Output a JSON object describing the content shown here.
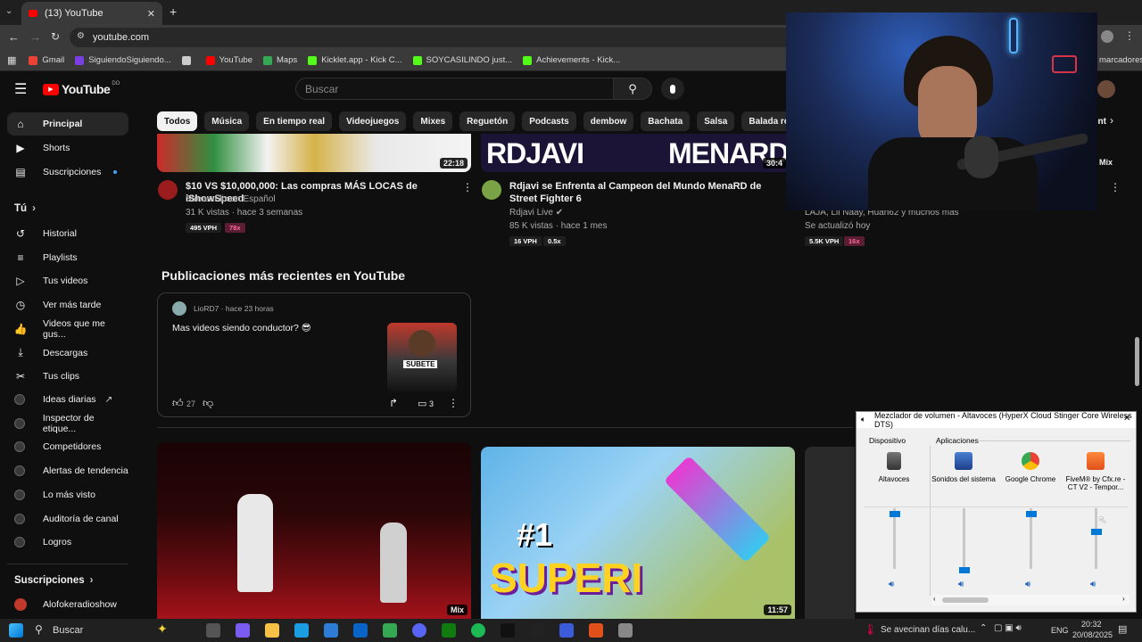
{
  "browser": {
    "tab_title": "(13) YouTube",
    "url": "youtube.com",
    "bookmarks": [
      {
        "label": "Gmail",
        "color": "#ea4335"
      },
      {
        "label": "SiguiendoSiguiendo...",
        "color": "#7b3fe4"
      },
      {
        "label": "",
        "color": "#cccccc"
      },
      {
        "label": "YouTube",
        "color": "#ff0000"
      },
      {
        "label": "Maps",
        "color": "#34a853"
      },
      {
        "label": "Kicklet.app - Kick C...",
        "color": "#53fc18"
      },
      {
        "label": "SOYCASILINDO just...",
        "color": "#53fc18"
      },
      {
        "label": "Achievements - Kick...",
        "color": "#53fc18"
      }
    ],
    "bookmarks_right": "marcadores"
  },
  "youtube": {
    "logo": "YouTube",
    "logo_sup": "DO",
    "search_placeholder": "Buscar",
    "chips": [
      "Todos",
      "Música",
      "En tiempo real",
      "Videojuegos",
      "Mixes",
      "Reguetón",
      "Podcasts",
      "dembow",
      "Bachata",
      "Salsa",
      "Balada románticas"
    ],
    "chip_partial": "ent"
  },
  "sidebar": {
    "top": [
      {
        "label": "Principal",
        "icon": "home-icon",
        "glyph": "⌂"
      },
      {
        "label": "Shorts",
        "icon": "shorts-icon",
        "glyph": "▶"
      },
      {
        "label": "Suscripciones",
        "icon": "subscriptions-icon",
        "glyph": "▤"
      }
    ],
    "you_heading": "Tú",
    "you": [
      {
        "label": "Historial",
        "icon": "history-icon",
        "glyph": "↺"
      },
      {
        "label": "Playlists",
        "icon": "playlists-icon",
        "glyph": "≡"
      },
      {
        "label": "Tus videos",
        "icon": "your-videos-icon",
        "glyph": "▷"
      },
      {
        "label": "Ver más tarde",
        "icon": "watch-later-icon",
        "glyph": "◷"
      },
      {
        "label": "Videos que me gus...",
        "icon": "liked-icon",
        "glyph": "👍"
      },
      {
        "label": "Descargas",
        "icon": "downloads-icon",
        "glyph": "⤓"
      },
      {
        "label": "Tus clips",
        "icon": "clips-icon",
        "glyph": "✂"
      }
    ],
    "tools": [
      {
        "label": "Ideas diarias"
      },
      {
        "label": "Inspector de etique..."
      },
      {
        "label": "Competidores"
      },
      {
        "label": "Alertas de tendencia"
      },
      {
        "label": "Lo más visto"
      },
      {
        "label": "Auditoría de canal"
      },
      {
        "label": "Logros"
      }
    ],
    "subs_heading": "Suscripciones",
    "subs": [
      {
        "label": "Alofokeradioshow"
      }
    ]
  },
  "videos_top": [
    {
      "title": "$10 VS $10,000,000: Las compras MÁS LOCAS de iShowSpeed",
      "channel": "StreamFlix en Español",
      "meta": "31 K vistas · hace 3 semanas",
      "duration": "22:18",
      "vph": "495 VPH",
      "mult": "78x"
    },
    {
      "title": "Rdjavi se Enfrenta al Campeon del Mundo MenaRD de Street Fighter 6",
      "channel": "Rdjavi Live",
      "meta": "85 K vistas · hace 1 mes",
      "duration": "30:4",
      "vph": "16 VPH",
      "mult": "0.5x",
      "thumb_text_left": "RDJAVI",
      "thumb_text_right": "MENARD"
    },
    {
      "title": "",
      "channel": "LAJA, Lil Naay, Huan62 y muchos más",
      "meta": "Se actualizó hoy",
      "duration": "Mix",
      "vph": "5.5K VPH",
      "mult": "16x"
    }
  ],
  "posts": {
    "heading": "Publicaciones más recientes en YouTube",
    "author": "LioRD7",
    "time": "hace 23 horas",
    "text": "Mas videos siendo conductor? 😎",
    "likes": "27",
    "comments": "3",
    "thumb_label": "SUBETE"
  },
  "videos_bottom": [
    {
      "duration": "Mix"
    },
    {
      "duration": "11:57",
      "thumb_text": "SUPERI",
      "thumb_badge": "#1"
    }
  ],
  "mixer": {
    "title": "Mezclador de volumen - Altavoces (HyperX Cloud Stinger Core Wireless DTS)",
    "device_heading": "Dispositivo",
    "apps_heading": "Aplicaciones",
    "columns": [
      {
        "label": "Altavoces",
        "level": 0.95,
        "icon": "speaker-device-icon"
      },
      {
        "label": "Sonidos del sistema",
        "level": 0.0,
        "icon": "system-sounds-icon"
      },
      {
        "label": "Google Chrome",
        "level": 0.95,
        "icon": "chrome-icon"
      },
      {
        "label": "FiveM® by Cfx.re - CT V2 - Tempor...",
        "level": 0.65,
        "icon": "fivem-icon"
      }
    ]
  },
  "taskbar": {
    "search": "Buscar",
    "notification": "Se avecinan días calu...",
    "lang": "ENG",
    "time": "20:32",
    "date": "20/08/2025"
  },
  "colors": {
    "yt_red": "#ff0000",
    "chip_active": "#f1f1f1",
    "mixer_accent": "#0078d7"
  }
}
